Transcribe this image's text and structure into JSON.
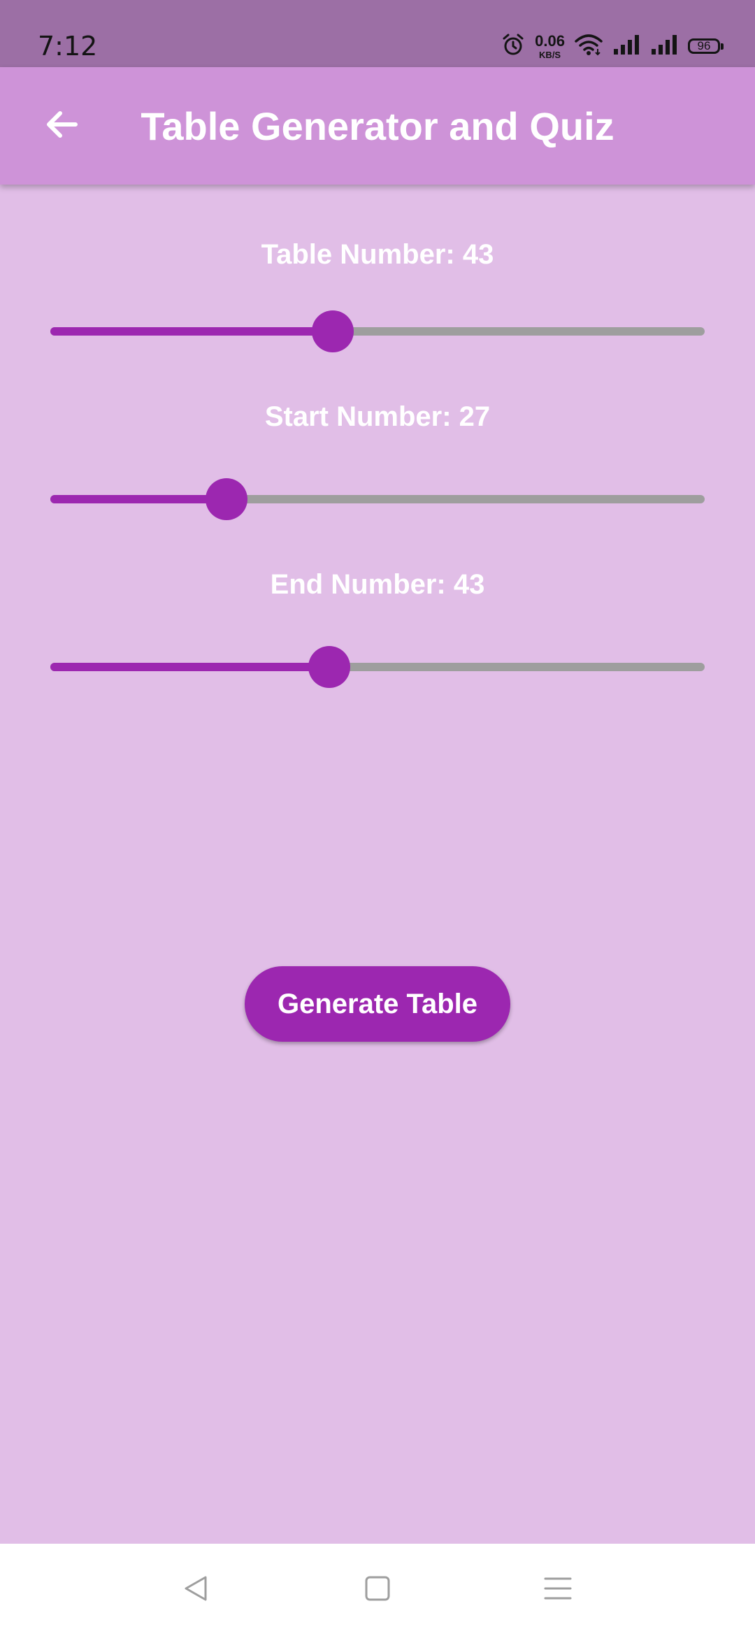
{
  "status_bar": {
    "time": "7:12",
    "net_speed_value": "0.06",
    "net_speed_unit": "KB/S",
    "battery_level": "96",
    "icons": [
      "alarm-icon",
      "wifi-icon",
      "signal-icon",
      "signal-icon",
      "battery-icon"
    ]
  },
  "app_bar": {
    "title": "Table Generator and Quiz",
    "back_icon": "arrow-left-icon"
  },
  "sliders": {
    "table_number": {
      "label": "Table Number: 43",
      "fraction": 0.432
    },
    "start_number": {
      "label": "Start Number: 27",
      "fraction": 0.269
    },
    "end_number": {
      "label": "End Number: 43",
      "fraction": 0.426
    }
  },
  "generate_button": {
    "label": "Generate Table"
  },
  "nav_bar": {
    "items": [
      "back-triangle-icon",
      "home-square-icon",
      "menu-lines-icon"
    ]
  },
  "colors": {
    "background": "#e1bee7",
    "app_bar": "#ce93d8",
    "status_bar": "#9c6fa5",
    "accent": "#9c27b0",
    "track_inactive": "#9e9e9e"
  }
}
